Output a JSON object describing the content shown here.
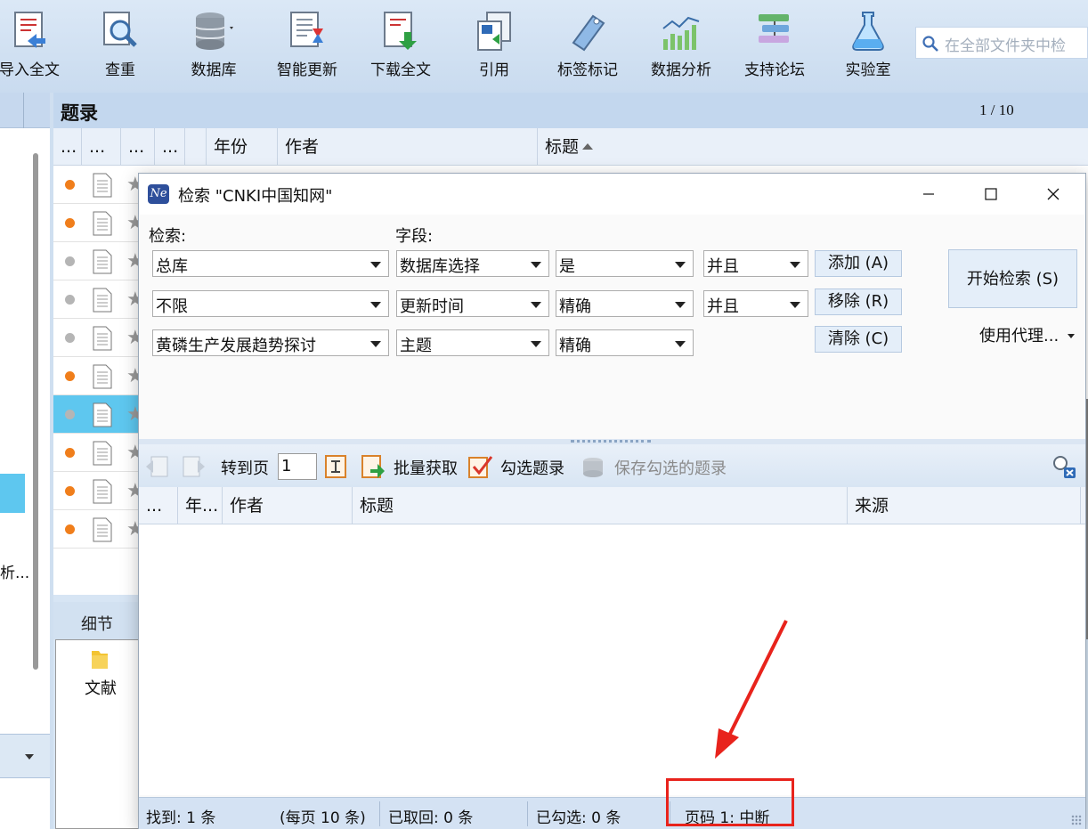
{
  "toolbar": {
    "items": [
      {
        "label": "导入全文",
        "icon": "import-fulltext-icon"
      },
      {
        "label": "查重",
        "icon": "duplicate-check-icon"
      },
      {
        "label": "数据库",
        "icon": "database-icon"
      },
      {
        "label": "智能更新",
        "icon": "smart-update-icon"
      },
      {
        "label": "下载全文",
        "icon": "download-fulltext-icon"
      },
      {
        "label": "引用",
        "icon": "cite-icon"
      },
      {
        "label": "标签标记",
        "icon": "tag-icon"
      },
      {
        "label": "数据分析",
        "icon": "data-analysis-icon"
      },
      {
        "label": "支持论坛",
        "icon": "forum-icon"
      },
      {
        "label": "实验室",
        "icon": "lab-flask-icon"
      }
    ],
    "search_placeholder": "在全部文件夹中检"
  },
  "left_panel": {
    "truncated_text": "析..."
  },
  "list": {
    "title": "题录",
    "page": "1 / 10",
    "columns": [
      "...",
      "...",
      "...",
      "...",
      "",
      "年份",
      "作者",
      "标题"
    ],
    "sorted_column": "标题",
    "rows": [
      {
        "status": "orange",
        "selected": false
      },
      {
        "status": "orange",
        "selected": false
      },
      {
        "status": "gray",
        "selected": false
      },
      {
        "status": "gray",
        "selected": false
      },
      {
        "status": "gray",
        "selected": false
      },
      {
        "status": "orange",
        "selected": false
      },
      {
        "status": "gray",
        "selected": true
      },
      {
        "status": "orange",
        "selected": false
      },
      {
        "status": "orange",
        "selected": false
      },
      {
        "status": "orange",
        "selected": false
      }
    ]
  },
  "detail": {
    "tab_label": "细节",
    "folder_label": "文献"
  },
  "dialog": {
    "title": "检索 \"CNKI中国知网\"",
    "labels": {
      "search": "检索:",
      "field": "字段:"
    },
    "rows": [
      {
        "term": "总库",
        "field": "数据库选择",
        "match": "是",
        "logic": "并且"
      },
      {
        "term": "不限",
        "field": "更新时间",
        "match": "精确",
        "logic": "并且"
      },
      {
        "term": "黄磷生产发展趋势探讨",
        "field": "主题",
        "match": "精确"
      }
    ],
    "buttons": {
      "add": "添加 (A)",
      "remove": "移除 (R)",
      "clear": "清除 (C)",
      "start": "开始检索 (S)",
      "proxy": "使用代理..."
    },
    "results_toolbar": {
      "goto_label": "转到页",
      "page_value": "1",
      "batch_fetch": "批量获取",
      "check_records": "勾选题录",
      "save_checked": "保存勾选的题录"
    },
    "results_columns": [
      "...",
      "年...",
      "作者",
      "标题",
      "来源"
    ],
    "status": {
      "found": "找到: 1 条",
      "per_page": "(每页 10 条)",
      "retrieved": "已取回: 0 条",
      "checked": "已勾选: 0 条",
      "page_state": "页码 1: 中断"
    }
  },
  "colors": {
    "accent_red": "#e8231c",
    "status_orange": "#f07e1b",
    "status_gray": "#b5b5b5",
    "selection_blue": "#5ec7ef"
  }
}
